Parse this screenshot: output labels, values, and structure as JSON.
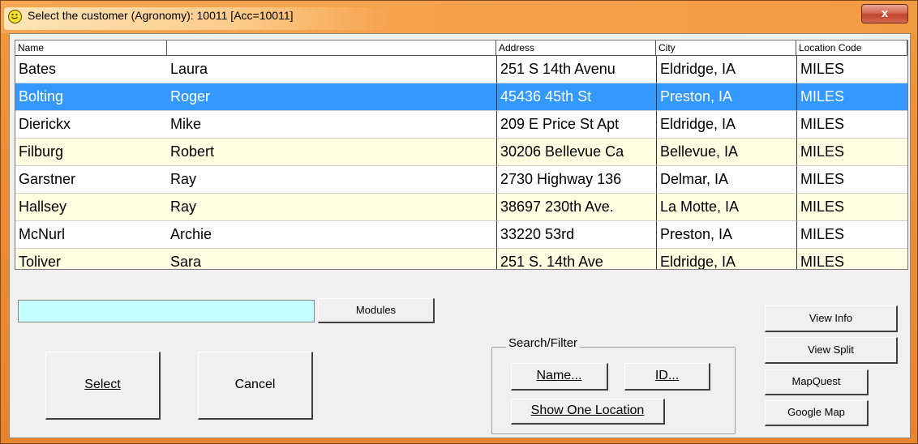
{
  "window": {
    "title": "Select the customer (Agronomy): 10011 [Acc=10011]",
    "close_label": "x",
    "icon": "smiley-icon"
  },
  "table": {
    "columns": [
      "Name",
      "",
      "Address",
      "City",
      "Location Code"
    ],
    "rows": [
      {
        "last": "Bates",
        "first": "Laura",
        "address": "251 S 14th Avenu",
        "city": "Eldridge, IA",
        "loc": "MILES"
      },
      {
        "last": "Bolting",
        "first": "Roger",
        "address": "45436 45th St",
        "city": "Preston, IA",
        "loc": "MILES"
      },
      {
        "last": "Dierickx",
        "first": "Mike",
        "address": "209 E Price St Apt",
        "city": "Eldridge, IA",
        "loc": "MILES"
      },
      {
        "last": "Filburg",
        "first": "Robert",
        "address": "30206 Bellevue Ca",
        "city": "Bellevue, IA",
        "loc": "MILES"
      },
      {
        "last": "Garstner",
        "first": "Ray",
        "address": "2730 Highway 136",
        "city": "Delmar, IA",
        "loc": "MILES"
      },
      {
        "last": "Hallsey",
        "first": "Ray",
        "address": "38697 230th Ave.",
        "city": "La Motte, IA",
        "loc": "MILES"
      },
      {
        "last": "McNurl",
        "first": "Archie",
        "address": "33220 53rd",
        "city": "Preston, IA",
        "loc": "MILES"
      },
      {
        "last": "Toliver",
        "first": "Sara",
        "address": "251 S. 14th Ave",
        "city": "Eldridge, IA",
        "loc": "MILES"
      }
    ],
    "selected_row_color": "#3399ff",
    "alt_row_color": "#ffffe1"
  },
  "search": {
    "value": "",
    "placeholder": ""
  },
  "buttons": {
    "modules": "Modules",
    "select": "Select",
    "cancel": "Cancel",
    "view_info": "View Info",
    "view_split": "View Split",
    "mapquest": "MapQuest",
    "google_map": "Google Map"
  },
  "search_filter": {
    "label": "Search/Filter",
    "name_button": "Name...",
    "id_button": "ID...",
    "show_one_location": "Show One Location"
  }
}
